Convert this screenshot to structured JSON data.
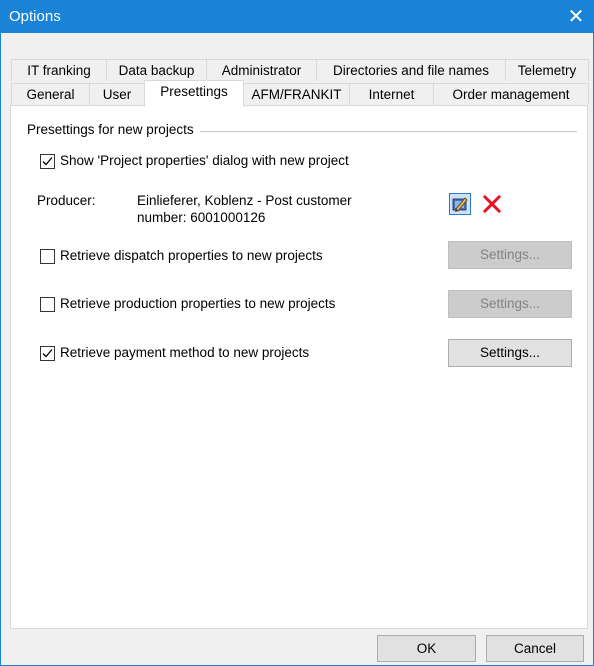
{
  "window": {
    "title": "Options"
  },
  "tabs_back": [
    "IT franking",
    "Data backup",
    "Administrator",
    "Directories and file names",
    "Telemetry"
  ],
  "tabs_front": [
    "General",
    "User",
    "Presettings",
    "AFM/FRANKIT",
    "Internet",
    "Order management"
  ],
  "active_tab": "Presettings",
  "group": {
    "title": "Presettings for new projects"
  },
  "show_dialog": {
    "label": "Show 'Project properties' dialog with new project",
    "checked": true
  },
  "producer": {
    "label": "Producer:",
    "value_line1": "Einlieferer, Koblenz - Post customer",
    "value_line2": "number: 6001000126",
    "edit_icon": "edit-producer-icon",
    "remove_icon": "remove-producer-icon"
  },
  "dispatch": {
    "label": "Retrieve dispatch properties to new projects",
    "checked": false,
    "settings": "Settings...",
    "enabled": false
  },
  "production": {
    "label": "Retrieve production properties to new projects",
    "checked": false,
    "settings": "Settings...",
    "enabled": false
  },
  "payment": {
    "label": "Retrieve payment method to new projects",
    "checked": true,
    "settings": "Settings...",
    "enabled": true
  },
  "buttons": {
    "ok": "OK",
    "cancel": "Cancel"
  },
  "colors": {
    "titlebar": "#1883d7",
    "remove_x": "#e81123"
  }
}
